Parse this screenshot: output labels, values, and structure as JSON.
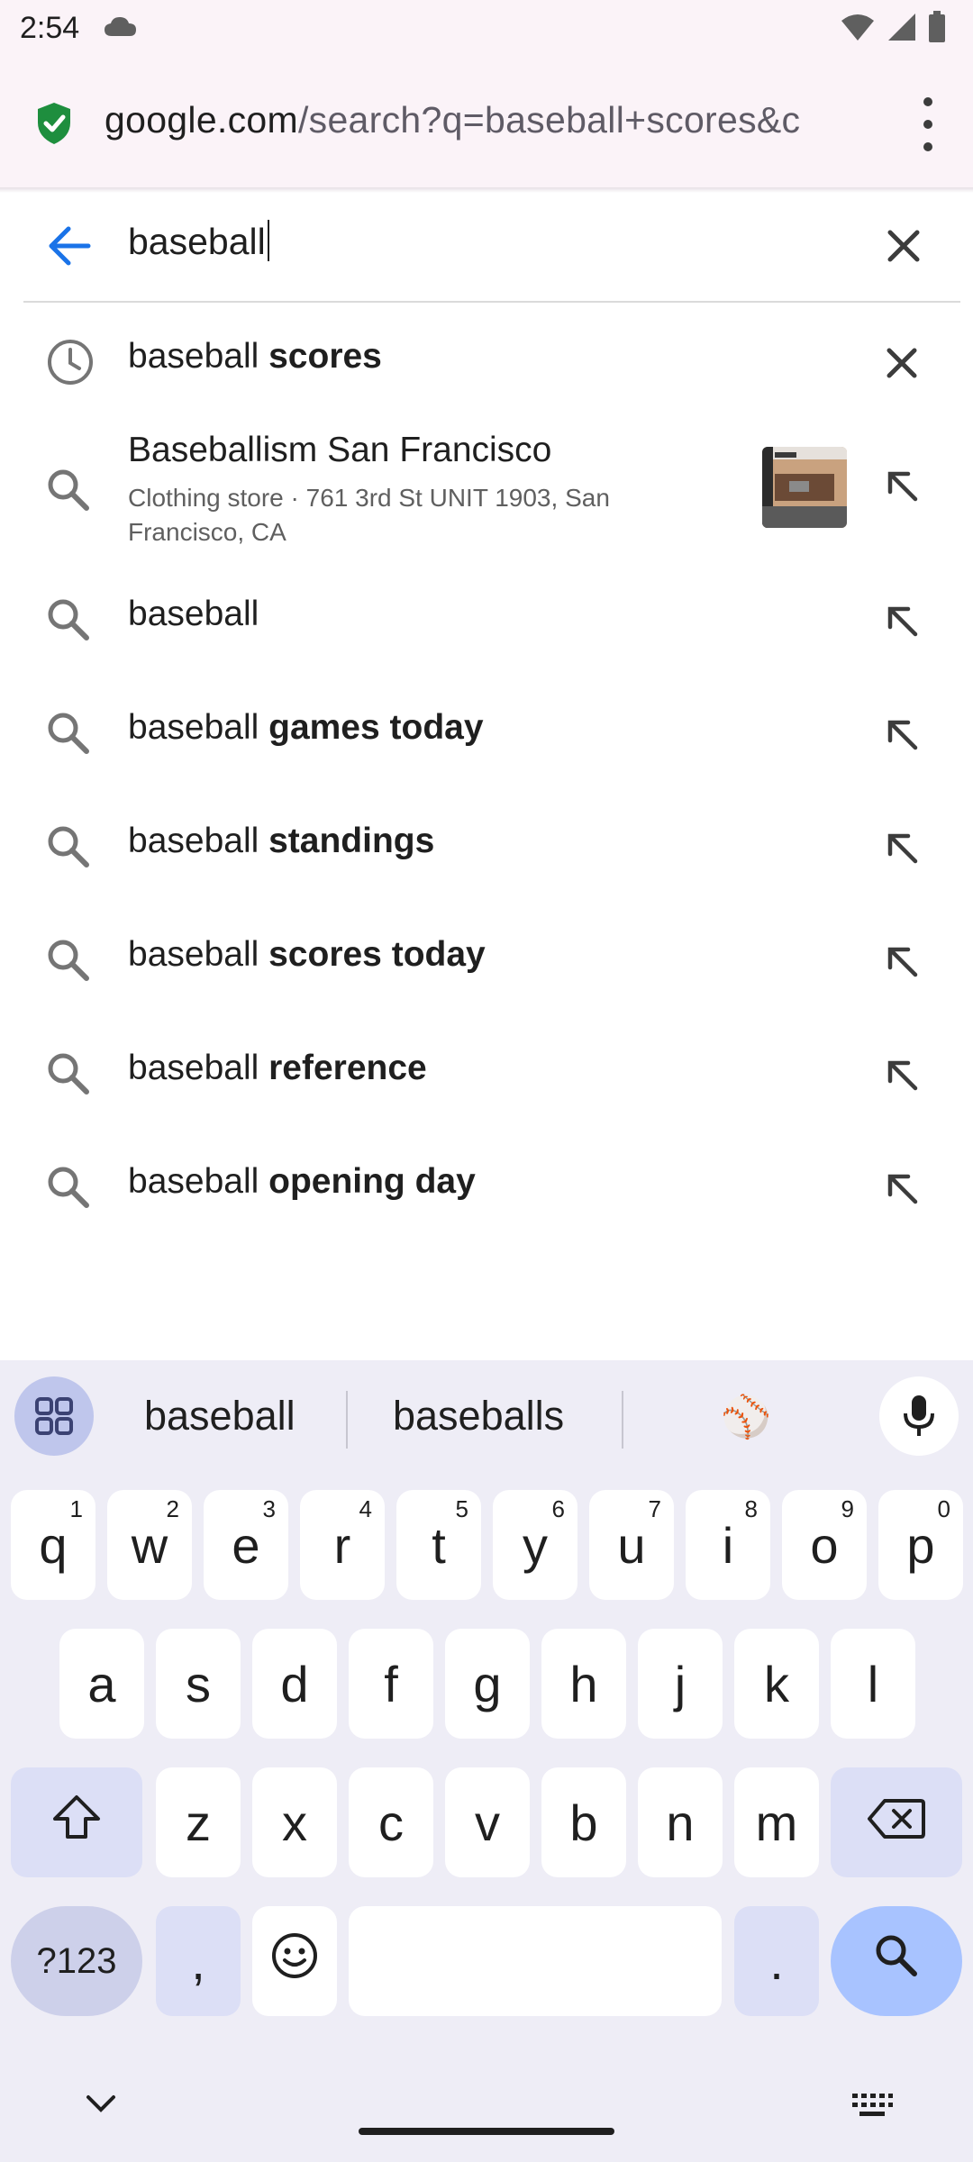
{
  "status": {
    "time": "2:54",
    "icons": [
      "cloud-icon",
      "wifi-icon",
      "signal-icon",
      "battery-icon"
    ]
  },
  "urlbar": {
    "domain": "google.com",
    "path": "/search?q=baseball+scores&c",
    "icons": [
      "security-lock-icon",
      "more-vert-icon"
    ]
  },
  "search": {
    "query": "baseball",
    "icons": [
      "back-arrow-icon",
      "clear-icon"
    ]
  },
  "suggestions": [
    {
      "type": "history",
      "prefix": "baseball",
      "bold": " scores",
      "icon": "history-icon",
      "trail_icon": "remove-icon"
    },
    {
      "type": "place",
      "title": "Baseballism San Francisco",
      "subtitle": "Clothing store · 761 3rd St UNIT 1903, San Francisco, CA",
      "icon": "search-icon",
      "trail_icon": "refine-arrow-icon"
    },
    {
      "type": "query",
      "prefix": "baseball",
      "bold": "",
      "icon": "search-icon",
      "trail_icon": "refine-arrow-icon"
    },
    {
      "type": "query",
      "prefix": "baseball",
      "bold": " games today",
      "icon": "search-icon",
      "trail_icon": "refine-arrow-icon"
    },
    {
      "type": "query",
      "prefix": "baseball",
      "bold": " standings",
      "icon": "search-icon",
      "trail_icon": "refine-arrow-icon"
    },
    {
      "type": "query",
      "prefix": "baseball",
      "bold": " scores today",
      "icon": "search-icon",
      "trail_icon": "refine-arrow-icon"
    },
    {
      "type": "query",
      "prefix": "baseball",
      "bold": " reference",
      "icon": "search-icon",
      "trail_icon": "refine-arrow-icon"
    },
    {
      "type": "query",
      "prefix": "baseball",
      "bold": " opening day",
      "icon": "search-icon",
      "trail_icon": "refine-arrow-icon"
    }
  ],
  "keyboard": {
    "suggestions": [
      "baseball",
      "baseballs",
      "⚾"
    ],
    "row1": [
      [
        "q",
        "1"
      ],
      [
        "w",
        "2"
      ],
      [
        "e",
        "3"
      ],
      [
        "r",
        "4"
      ],
      [
        "t",
        "5"
      ],
      [
        "y",
        "6"
      ],
      [
        "u",
        "7"
      ],
      [
        "i",
        "8"
      ],
      [
        "o",
        "9"
      ],
      [
        "p",
        "0"
      ]
    ],
    "row2": [
      "a",
      "s",
      "d",
      "f",
      "g",
      "h",
      "j",
      "k",
      "l"
    ],
    "row3": [
      "z",
      "x",
      "c",
      "v",
      "b",
      "n",
      "m"
    ],
    "symbols_label": "?123",
    "comma": ",",
    "period": ".",
    "icons": [
      "apps-grid-icon",
      "mic-icon",
      "shift-icon",
      "backspace-icon",
      "emoji-icon",
      "search-icon",
      "chevron-down-icon",
      "keyboard-icon"
    ]
  },
  "colors": {
    "chrome_bg": "#fbf3f8",
    "keyboard_bg": "#eeedf6",
    "accent_blue": "#1a73e8",
    "lock_green": "#1e8e3e",
    "enter_key": "#a8c3ff"
  }
}
